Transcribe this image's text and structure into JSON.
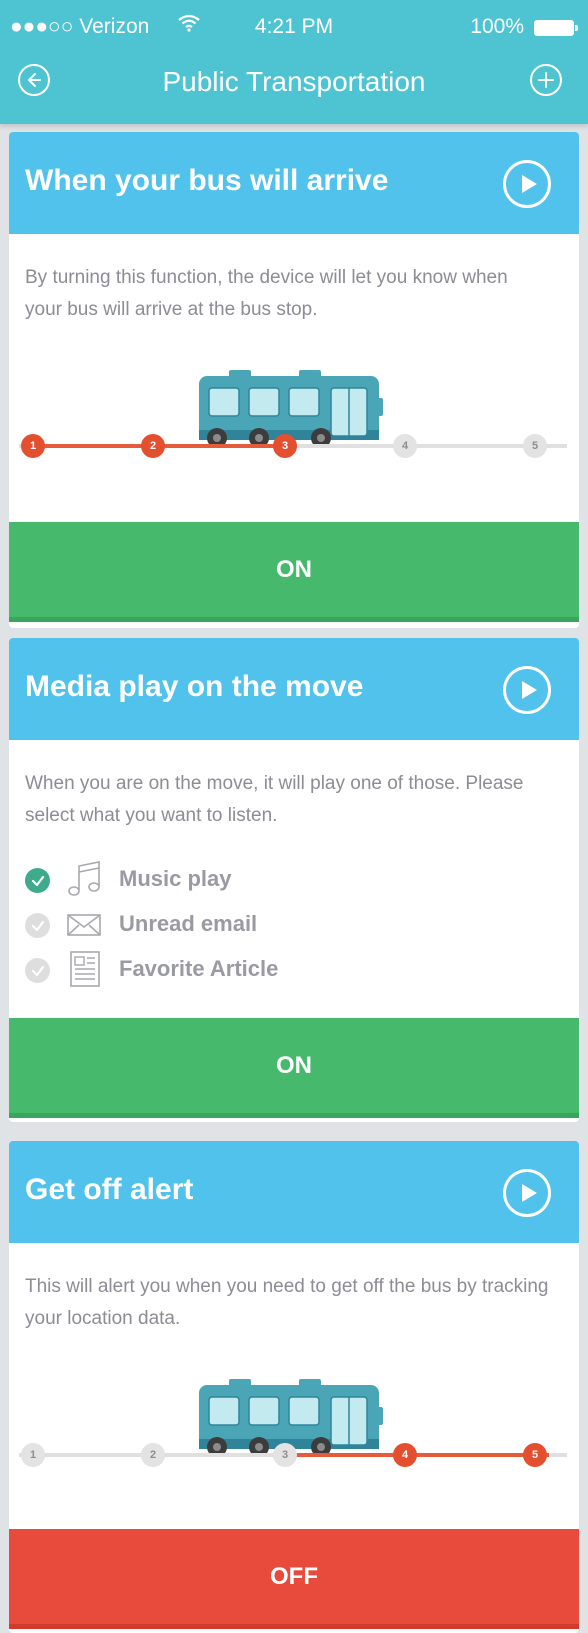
{
  "status_bar": {
    "carrier": "●●●○○ Verizon",
    "time": "4:21 PM",
    "battery": "100%"
  },
  "nav": {
    "title": "Public Transportation",
    "back_icon": "back-circle-icon",
    "add_icon": "plus-circle-icon"
  },
  "cards": [
    {
      "title": "When your bus will arrive",
      "description": "By turning this function, the device will let you know when your bus will arrive at the bus stop.",
      "stops": [
        "1",
        "2",
        "3",
        "4",
        "5"
      ],
      "active_stops": [
        1,
        2,
        3
      ],
      "toggle": "ON"
    },
    {
      "title": "Media play on the move",
      "description": "When you are on the move, it will play one of those. Please select what you want to listen.",
      "options": [
        {
          "label": "Music play",
          "icon": "music-note-icon",
          "selected": true
        },
        {
          "label": "Unread email",
          "icon": "envelope-icon",
          "selected": false
        },
        {
          "label": "Favorite Article",
          "icon": "article-icon",
          "selected": false
        }
      ],
      "toggle": "ON"
    },
    {
      "title": "Get off alert",
      "description": "This will alert you when you need to get off the bus by tracking your location data.",
      "stops": [
        "1",
        "2",
        "3",
        "4",
        "5"
      ],
      "active_stops": [
        4,
        5
      ],
      "toggle": "OFF"
    }
  ],
  "colors": {
    "nav": "#4ec4d3",
    "card_header": "#50c2ec",
    "on": "#47b96c",
    "off": "#e84b3b",
    "progress": "#e45c3b",
    "bus": "#4aa5b7"
  }
}
